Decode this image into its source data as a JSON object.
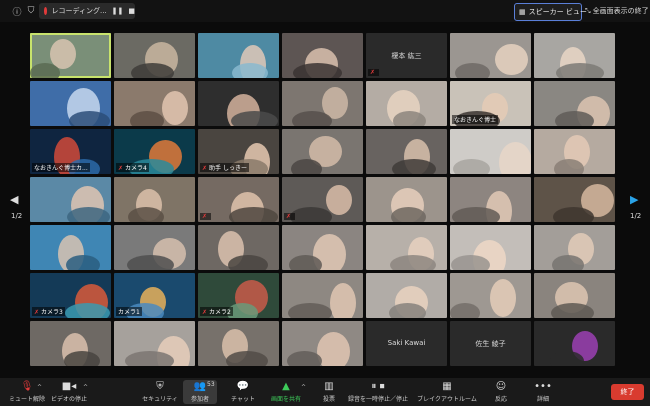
{
  "topbar": {
    "recording_label": "レコーディング...",
    "rec_pause": "❚❚",
    "rec_stop": "■",
    "speaker_view": "スピーカー ビュー",
    "exit_fullscreen": "全画面表示の終了"
  },
  "pagination": {
    "left": "1/2",
    "right": "1/2"
  },
  "tiles": [
    {
      "name": "",
      "center": "",
      "muted": false,
      "bg": "#7a8f78",
      "b1": "#d8c4b0",
      "b2": "#5a6b52"
    },
    {
      "name": "",
      "center": "",
      "muted": false,
      "bg": "#6b6a63",
      "b1": "#c9b6a0",
      "b2": "#3e3c38"
    },
    {
      "name": "",
      "center": "",
      "muted": false,
      "bg": "#4e8aa3",
      "b1": "#e0c8b8",
      "b2": "#89b9cf"
    },
    {
      "name": "",
      "center": "",
      "muted": false,
      "bg": "#5d5553",
      "b1": "#d9c1ae",
      "b2": "#3a3432"
    },
    {
      "name": "",
      "center": "榎本 紘三",
      "muted": true,
      "bg": "#2a2a2a",
      "b1": "#2a2a2a",
      "b2": "#2a2a2a"
    },
    {
      "name": "",
      "center": "",
      "muted": false,
      "bg": "#9b9691",
      "b1": "#e6d2c0",
      "b2": "#6f6a65"
    },
    {
      "name": "",
      "center": "",
      "muted": false,
      "bg": "#a8a6a2",
      "b1": "#e9d6c6",
      "b2": "#7d7a76"
    },
    {
      "name": "",
      "center": "",
      "muted": false,
      "bg": "#3f6da8",
      "b1": "#c7d8ee",
      "b2": "#2c4d79"
    },
    {
      "name": "",
      "center": "",
      "muted": false,
      "bg": "#8b7a6c",
      "b1": "#e2c6b0",
      "b2": "#5d4f44"
    },
    {
      "name": "",
      "center": "",
      "muted": false,
      "bg": "#2e2e2e",
      "b1": "#d3b29c",
      "b2": "#4a4a4a"
    },
    {
      "name": "",
      "center": "",
      "muted": false,
      "bg": "#7d7670",
      "b1": "#cdb8a6",
      "b2": "#56504b"
    },
    {
      "name": "",
      "center": "",
      "muted": false,
      "bg": "#b4aca4",
      "b1": "#e8d3c2",
      "b2": "#8c857e"
    },
    {
      "name": "なおきんぐ博士",
      "center": "",
      "muted": false,
      "bg": "#c9c2b8",
      "b1": "#e5cbb5",
      "b2": "#3a3430"
    },
    {
      "name": "",
      "center": "",
      "muted": false,
      "bg": "#8a8782",
      "b1": "#dcc4b2",
      "b2": "#5f5c58"
    },
    {
      "name": "なおきんぐ博士カ...",
      "center": "",
      "muted": false,
      "bg": "#0f2540",
      "b1": "#d14a3a",
      "b2": "#2b6aa8"
    },
    {
      "name": "カメラ4",
      "center": "",
      "muted": true,
      "bg": "#0b3a4a",
      "b1": "#e07a3a",
      "b2": "#2a8a9a"
    },
    {
      "name": "助手 しっきー",
      "center": "",
      "muted": true,
      "bg": "#4a4540",
      "b1": "#e6c9b2",
      "b2": "#8a7a6a"
    },
    {
      "name": "",
      "center": "",
      "muted": false,
      "bg": "#7a7570",
      "b1": "#d4bca8",
      "b2": "#4b4743"
    },
    {
      "name": "",
      "center": "",
      "muted": false,
      "bg": "#686360",
      "b1": "#d8c0ab",
      "b2": "#3f3b38"
    },
    {
      "name": "",
      "center": "",
      "muted": false,
      "bg": "#cfccc8",
      "b1": "#e8d6c8",
      "b2": "#a8a4a0"
    },
    {
      "name": "",
      "center": "",
      "muted": false,
      "bg": "#b5aaa0",
      "b1": "#e4cab6",
      "b2": "#8a7f76"
    },
    {
      "name": "",
      "center": "",
      "muted": false,
      "bg": "#5b89a6",
      "b1": "#e0c6b2",
      "b2": "#3d6680"
    },
    {
      "name": "",
      "center": "",
      "muted": false,
      "bg": "#7f7466",
      "b1": "#dcc1aa",
      "b2": "#5a5045"
    },
    {
      "name": "",
      "center": "",
      "muted": true,
      "bg": "#756a62",
      "b1": "#e1c3ad",
      "b2": "#4f4640"
    },
    {
      "name": "",
      "center": "",
      "muted": true,
      "bg": "#5e5a57",
      "b1": "#d9bda8",
      "b2": "#3b3836"
    },
    {
      "name": "",
      "center": "",
      "muted": false,
      "bg": "#9c948c",
      "b1": "#e7cfbc",
      "b2": "#6e6760"
    },
    {
      "name": "",
      "center": "",
      "muted": false,
      "bg": "#8d8580",
      "b1": "#e2c9b6",
      "b2": "#625b56"
    },
    {
      "name": "",
      "center": "",
      "muted": false,
      "bg": "#5e5348",
      "b1": "#d6b8a0",
      "b2": "#3e362f"
    },
    {
      "name": "",
      "center": "",
      "muted": false,
      "bg": "#3f86b4",
      "b1": "#d8c3b2",
      "b2": "#2a5e80"
    },
    {
      "name": "",
      "center": "",
      "muted": false,
      "bg": "#7a7a7a",
      "b1": "#d6c0ae",
      "b2": "#4f4f4f"
    },
    {
      "name": "",
      "center": "",
      "muted": false,
      "bg": "#6e6863",
      "b1": "#dcc2ae",
      "b2": "#4a4541"
    },
    {
      "name": "",
      "center": "",
      "muted": false,
      "bg": "#8b8581",
      "b1": "#e0c8b5",
      "b2": "#5f5a56"
    },
    {
      "name": "",
      "center": "",
      "muted": false,
      "bg": "#b7b0a9",
      "b1": "#e8d1bf",
      "b2": "#8d8680"
    },
    {
      "name": "",
      "center": "",
      "muted": false,
      "bg": "#c3beb9",
      "b1": "#eed8c6",
      "b2": "#99948f"
    },
    {
      "name": "",
      "center": "",
      "muted": false,
      "bg": "#a39e99",
      "b1": "#e3cbb8",
      "b2": "#777370"
    },
    {
      "name": "カメラ3",
      "center": "",
      "muted": true,
      "bg": "#143a57",
      "b1": "#d85a3a",
      "b2": "#3a9ab0"
    },
    {
      "name": "カメラ1",
      "center": "",
      "muted": false,
      "bg": "#1a4a6e",
      "b1": "#e8b05a",
      "b2": "#4a8ac0"
    },
    {
      "name": "カメラ2",
      "center": "",
      "muted": true,
      "bg": "#2f4a3a",
      "b1": "#c85a4a",
      "b2": "#6a9a7a"
    },
    {
      "name": "",
      "center": "",
      "muted": false,
      "bg": "#8e8882",
      "b1": "#e1c7b3",
      "b2": "#635d58"
    },
    {
      "name": "",
      "center": "",
      "muted": false,
      "bg": "#b1aca7",
      "b1": "#ead2c0",
      "b2": "#86817c"
    },
    {
      "name": "",
      "center": "",
      "muted": false,
      "bg": "#9e9892",
      "b1": "#e4ccb9",
      "b2": "#736d68"
    },
    {
      "name": "",
      "center": "",
      "muted": false,
      "bg": "#8a847e",
      "b1": "#ddc5b2",
      "b2": "#5e5954"
    },
    {
      "name": "",
      "center": "",
      "muted": false,
      "bg": "#6e6964",
      "b1": "#dbc1ad",
      "b2": "#48443f"
    },
    {
      "name": "",
      "center": "",
      "muted": false,
      "bg": "#a6a19c",
      "b1": "#e6cebb",
      "b2": "#7b7672"
    },
    {
      "name": "",
      "center": "",
      "muted": false,
      "bg": "#77716b",
      "b1": "#d9bfaa",
      "b2": "#514b46"
    },
    {
      "name": "",
      "center": "",
      "muted": false,
      "bg": "#8f8984",
      "b1": "#e0c6b2",
      "b2": "#635e59"
    },
    {
      "name": "",
      "center": "Saki Kawai",
      "muted": false,
      "bg": "#2a2a2a",
      "b1": "#2a2a2a",
      "b2": "#2a2a2a"
    },
    {
      "name": "",
      "center": "佐生 綾子",
      "muted": false,
      "bg": "#2a2a2a",
      "b1": "#2a2a2a",
      "b2": "#2a2a2a"
    },
    {
      "name": "",
      "center": "",
      "muted": false,
      "bg": "#2a2a2a",
      "b1": "#9b3fb3",
      "b2": "#2a2a2a"
    }
  ],
  "toolbar": {
    "mute": "ミュート解除",
    "video": "ビデオの停止",
    "security": "セキュリティ",
    "participants": "参加者",
    "participants_count": "53",
    "chat": "チャット",
    "share": "画面を共有",
    "poll": "投票",
    "recording": "録音を一時停止／停止",
    "breakout": "ブレイクアウトルーム",
    "reactions": "反応",
    "more": "詳細",
    "end": "終了"
  },
  "colors": {
    "accent": "#c8e36c",
    "end": "#d93b2f",
    "share_green": "#3dcb5a"
  }
}
